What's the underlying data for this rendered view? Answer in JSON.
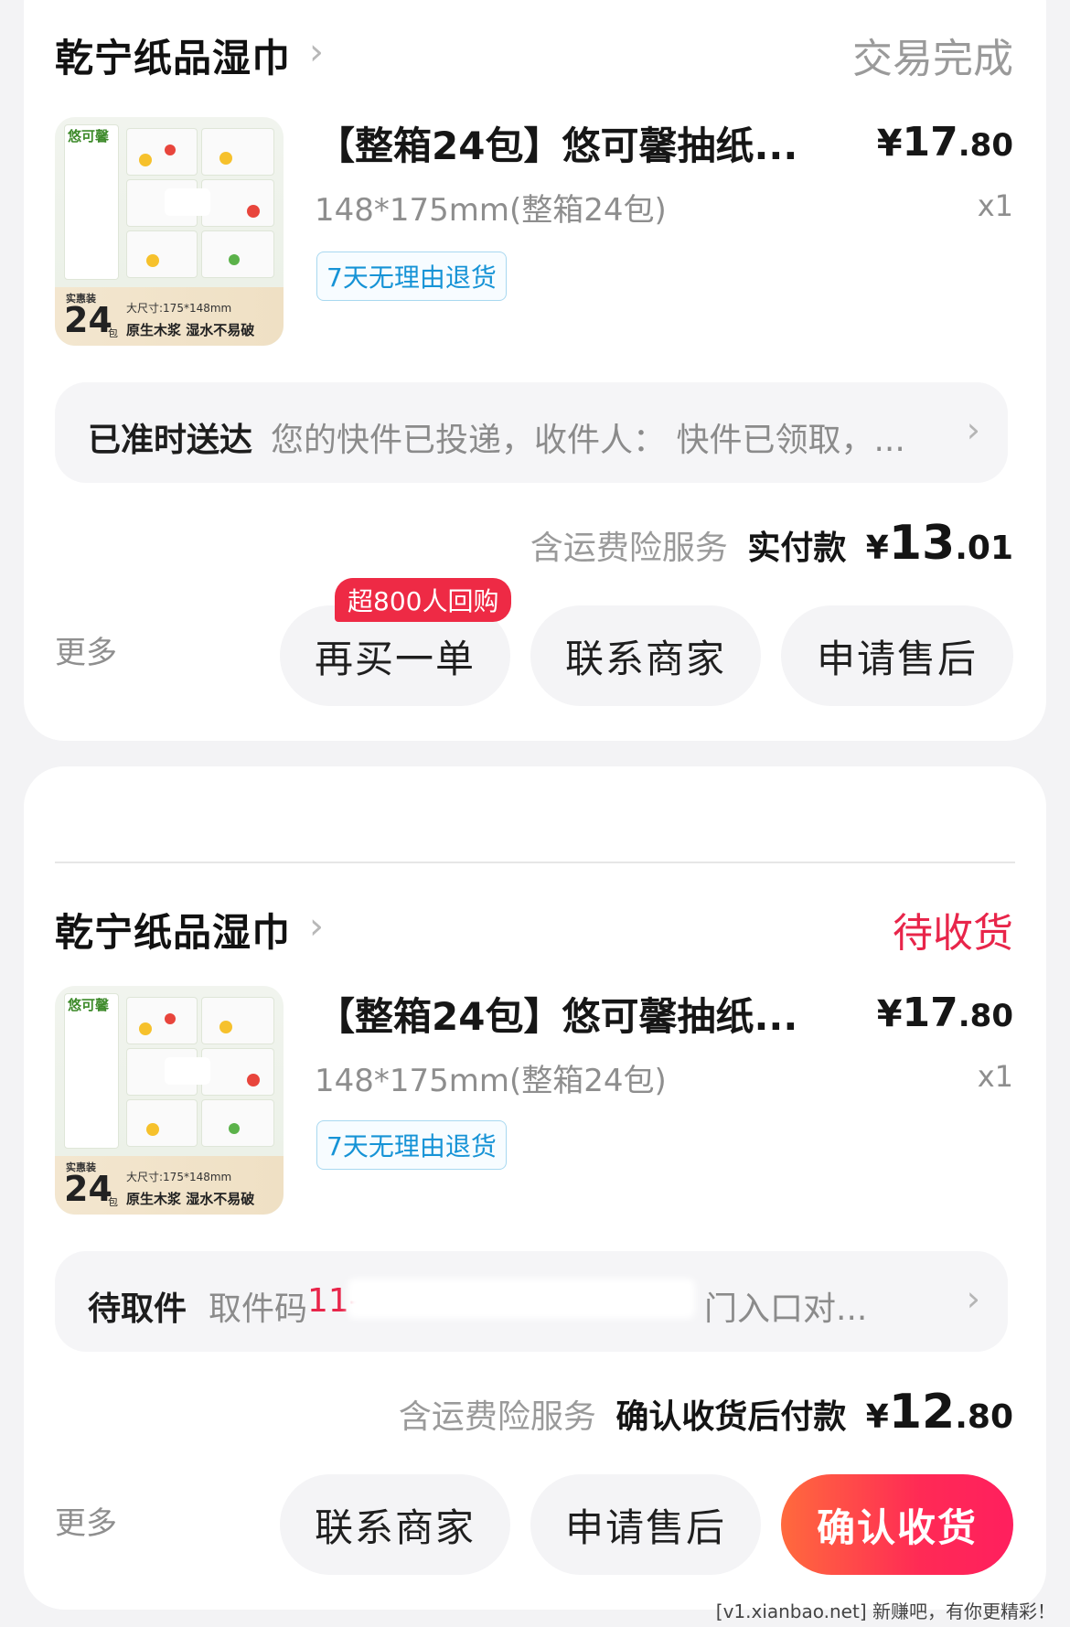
{
  "orders": [
    {
      "shop_name": "乾宁纸品湿巾",
      "status": "交易完成",
      "product": {
        "thumb_brand": "悠可馨",
        "thumb_badge": "实惠装",
        "thumb_count": "24",
        "thumb_count_unit": "包",
        "thumb_size": "大尺寸:175*148mm",
        "thumb_slogan": "原生木浆 湿水不易破",
        "title": "【整箱24包】悠可馨抽纸...",
        "price_symbol": "¥",
        "price_int": "17",
        "price_dec": ".80",
        "spec": "148*175mm(整箱24包)",
        "qty": "x1",
        "tag": "7天无理由退货"
      },
      "logistics": {
        "status": "已准时送达",
        "detail": "您的快件已投递，收件人： 快件已领取，..."
      },
      "summary": {
        "service": "含运费险服务",
        "label": "实付款",
        "amount_symbol": "¥",
        "amount_int": "13",
        "amount_dec": ".01"
      },
      "actions": {
        "more": "更多",
        "buy_again": "再买一单",
        "buy_again_badge": "超800人回购",
        "contact": "联系商家",
        "after_sale": "申请售后"
      }
    },
    {
      "shop_name": "乾宁纸品湿巾",
      "status": "待收货",
      "product": {
        "thumb_brand": "悠可馨",
        "thumb_badge": "实惠装",
        "thumb_count": "24",
        "thumb_count_unit": "包",
        "thumb_size": "大尺寸:175*148mm",
        "thumb_slogan": "原生木浆 湿水不易破",
        "title": "【整箱24包】悠可馨抽纸...",
        "price_symbol": "¥",
        "price_int": "17",
        "price_dec": ".80",
        "spec": "148*175mm(整箱24包)",
        "qty": "x1",
        "tag": "7天无理由退货"
      },
      "logistics": {
        "status": "待取件",
        "detail_prefix": "取件码",
        "detail_code": "11-",
        "detail_suffix": "门入口对..."
      },
      "summary": {
        "service": "含运费险服务",
        "label": "确认收货后付款",
        "amount_symbol": "¥",
        "amount_int": "12",
        "amount_dec": ".80"
      },
      "actions": {
        "more": "更多",
        "contact": "联系商家",
        "after_sale": "申请售后",
        "confirm": "确认收货"
      }
    }
  ],
  "watermark": "[v1.xianbao.net] 新赚吧，有你更精彩！",
  "colors": {
    "accent_red": "#e8254a",
    "tag_blue": "#1693d6",
    "page_bg": "#f3f3f5"
  }
}
